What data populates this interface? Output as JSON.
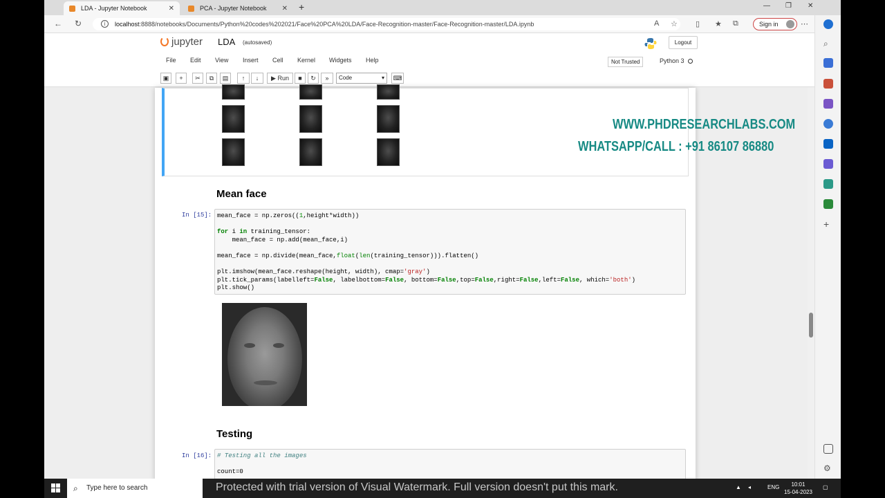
{
  "browser": {
    "tabs": [
      {
        "label": "LDA - Jupyter Notebook",
        "active": true
      },
      {
        "label": "PCA - Jupyter Notebook",
        "active": false
      }
    ],
    "url_host": "localhost",
    "url_rest": ":8888/notebooks/Documents/Python%20codes%202021/Face%20PCA%20LDA/Face-Recognition-master/Face-Recognition-master/LDA.ipynb",
    "signin_label": "Sign in"
  },
  "jupyter": {
    "logo_text": "jupyter",
    "notebook_title": "LDA",
    "autosave_status": "(autosaved)",
    "logout_label": "Logout",
    "menu": [
      "File",
      "Edit",
      "View",
      "Insert",
      "Cell",
      "Kernel",
      "Widgets",
      "Help"
    ],
    "trust_status": "Not Trusted",
    "kernel_name": "Python 3",
    "run_label": "Run",
    "cell_type": "Code"
  },
  "notebook": {
    "watermark_line1": "WWW.PHDRESEARCHLABS.COM",
    "watermark_line2": "WHATSAPP/CALL : +91 86107 86880",
    "heading_mean_face": "Mean face",
    "prompt_15": "In [15]:",
    "heading_testing": "Testing",
    "prompt_16": "In [16]:",
    "code16_comment": "# Testing all the images",
    "code16_line2": "count=0"
  },
  "taskbar": {
    "search_placeholder": "Type here to search",
    "watermark": "Protected with trial version of Visual Watermark. Full version doesn't put this mark.",
    "lang": "ENG",
    "time": "10:01",
    "date": "15-04-2023"
  }
}
